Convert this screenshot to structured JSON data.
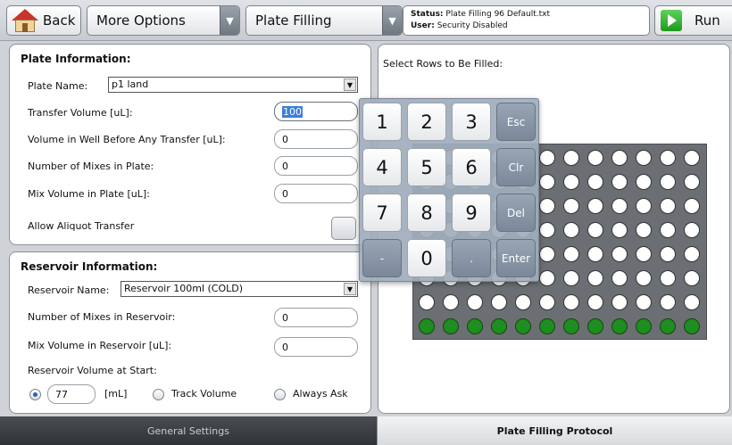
{
  "toolbar": {
    "back_label": "Back",
    "more_options_label": "More Options",
    "protocol_label": "Plate Filling",
    "status_key": "Status:",
    "status_value": "Plate Filling 96 Default.txt",
    "user_key": "User:",
    "user_value": "Security Disabled",
    "run_label": "Run"
  },
  "plate": {
    "title": "Plate Information:",
    "name_label": "Plate Name:",
    "name_value": "p1 land",
    "transfer_volume_label": "Transfer Volume [uL]:",
    "transfer_volume_value": "100",
    "volume_before_label": "Volume in Well Before Any Transfer [uL]:",
    "volume_before_value": "0",
    "mixes_label": "Number of Mixes in Plate:",
    "mixes_value": "0",
    "mix_volume_label": "Mix Volume in Plate [uL]:",
    "mix_volume_value": "0",
    "aliquot_label": "Allow Aliquot Transfer"
  },
  "reservoir": {
    "title": "Reservoir Information:",
    "name_label": "Reservoir Name:",
    "name_value": "Reservoir 100ml (COLD)",
    "mixes_label": "Number of Mixes in Reservoir:",
    "mixes_value": "0",
    "mix_volume_label": "Mix Volume in Reservoir [uL]:",
    "mix_volume_value": "0",
    "start_volume_label": "Reservoir Volume at Start:",
    "start_volume_value": "77",
    "unit_label": "[mL]",
    "track_label": "Track Volume",
    "ask_label": "Always Ask",
    "selected_option": "fixed"
  },
  "rows_panel": {
    "title": "Select Rows to Be Filled:",
    "row_colors": [
      "white",
      "white",
      "white",
      "white",
      "white",
      "white",
      "white",
      "green"
    ]
  },
  "keypad": {
    "keys": [
      "1",
      "2",
      "3",
      "Esc",
      "4",
      "5",
      "6",
      "Clr",
      "7",
      "8",
      "9",
      "Del",
      "-",
      "0",
      ".",
      "Enter"
    ]
  },
  "tabs": {
    "general": "General Settings",
    "protocol": "Plate Filling Protocol"
  },
  "colors": {
    "well_filled": "#1f8d1f",
    "accent": "#3d7fd6"
  }
}
